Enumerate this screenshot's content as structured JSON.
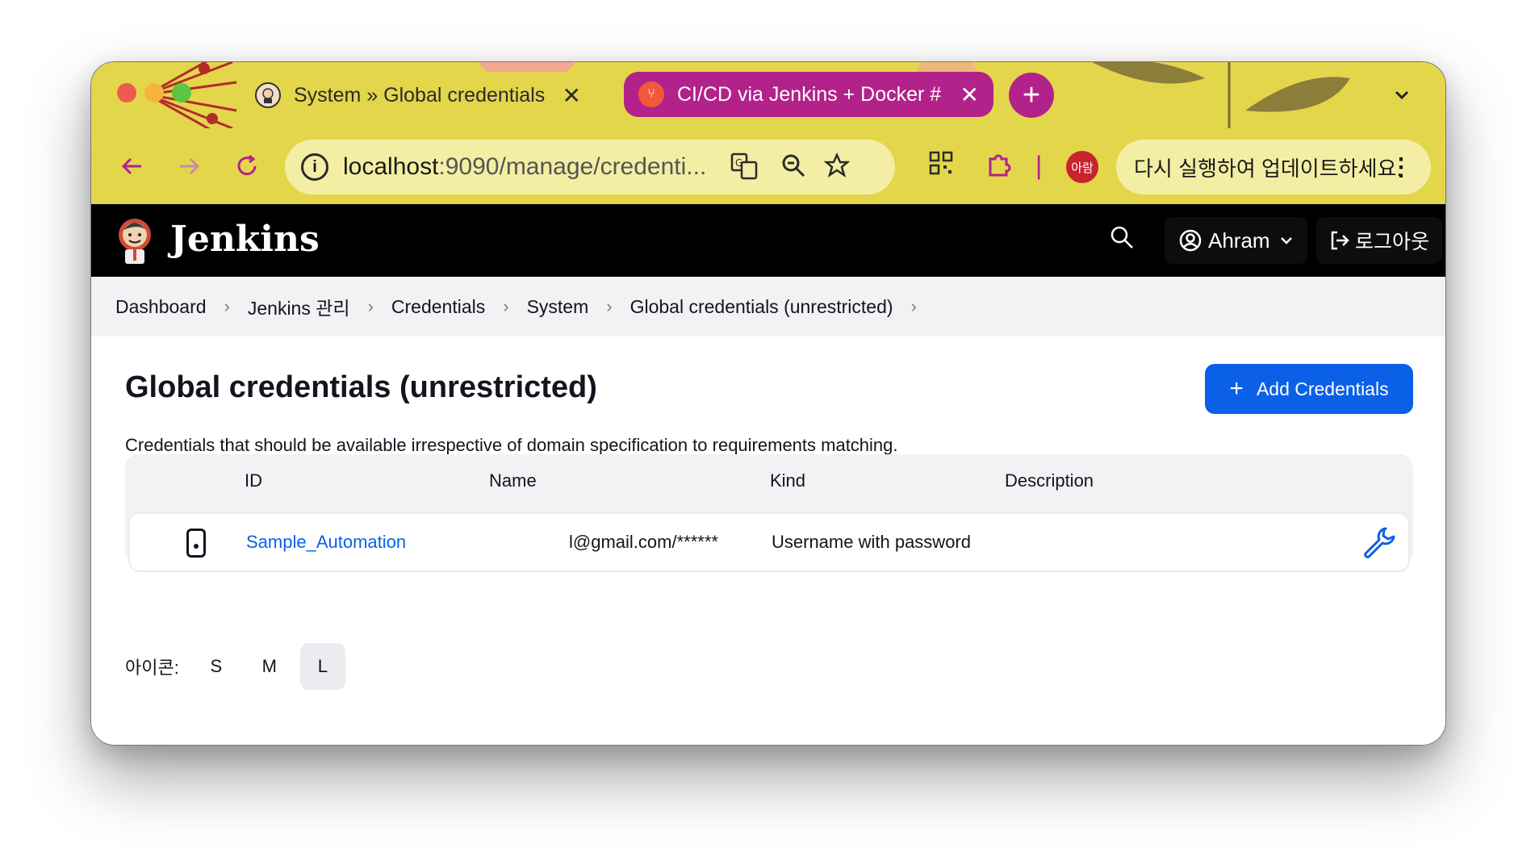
{
  "browser": {
    "tabs": [
      {
        "title": "System » Global credentials (",
        "active": true
      },
      {
        "title": "CI/CD via Jenkins + Docker #",
        "active": false
      }
    ],
    "new_tab_label": "+",
    "tab_menu_icon": "chevron-down-icon",
    "url_host": "localhost",
    "url_rest": ":9090/manage/credenti...",
    "profile_label": "아람",
    "update_prompt": "다시 실행하여 업데이트하세요.",
    "accent": "#b2228a",
    "chrome_color": "#e3d64b"
  },
  "header": {
    "title": "Jenkins",
    "user": "Ahram",
    "logout": "로그아웃"
  },
  "breadcrumb": [
    "Dashboard",
    "Jenkins 관리",
    "Credentials",
    "System",
    "Global credentials (unrestricted)"
  ],
  "page": {
    "title": "Global credentials (unrestricted)",
    "add_button": "Add Credentials",
    "description": "Credentials that should be available irrespective of domain specification to requirements matching."
  },
  "table": {
    "columns": [
      "ID",
      "Name",
      "Kind",
      "Description"
    ],
    "rows": [
      {
        "id": "Sample_Automation",
        "name": "l@gmail.com/******",
        "kind": "Username with password",
        "description": ""
      }
    ]
  },
  "icon_size": {
    "label": "아이콘:",
    "options": [
      "S",
      "M",
      "L"
    ],
    "selected": "L"
  },
  "colors": {
    "primary": "#0b60e8",
    "header_bg": "#000000",
    "breadcrumb_bg": "#f2f2f5"
  }
}
